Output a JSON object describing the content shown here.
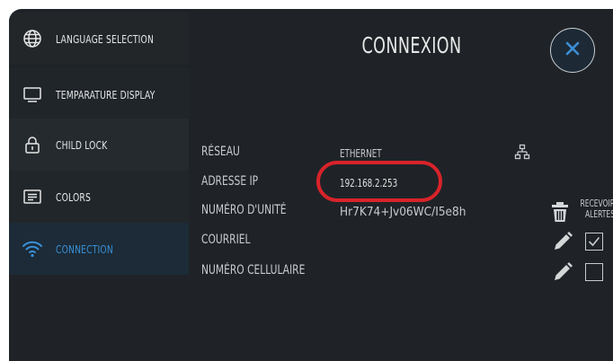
{
  "sidebar": {
    "items": [
      {
        "label": "LANGUAGE SELECTION",
        "icon": "globe-icon"
      },
      {
        "label": "TEMPARATURE DISPLAY",
        "icon": "monitor-icon"
      },
      {
        "label": "CHILD LOCK",
        "icon": "lock-icon"
      },
      {
        "label": "COLORS",
        "icon": "text-lines-icon"
      },
      {
        "label": "CONNECTION",
        "icon": "wifi-icon",
        "active": true
      }
    ]
  },
  "header": {
    "title": "CONNEXION",
    "close_label": "×"
  },
  "connection": {
    "rows": [
      {
        "label": "RÉSEAU",
        "value": "ETHERNET"
      },
      {
        "label": "ADRESSE IP",
        "value": "192.168.2.253"
      },
      {
        "label": "NUMÉRO D'UNITÉ",
        "value": "Hr7K74+Jv06WC/I5e8h"
      },
      {
        "label": "COURRIEL",
        "value": ""
      },
      {
        "label": "NUMÉRO CELLULAIRE",
        "value": ""
      }
    ],
    "receive_alerts_line1": "RECEVOIR",
    "receive_alerts_line2": "ALERTES",
    "email_alert_checked": true,
    "phone_alert_checked": false
  },
  "colors": {
    "accent": "#3a8fd6",
    "highlight": "#d8232a",
    "background": "#1f2327"
  }
}
